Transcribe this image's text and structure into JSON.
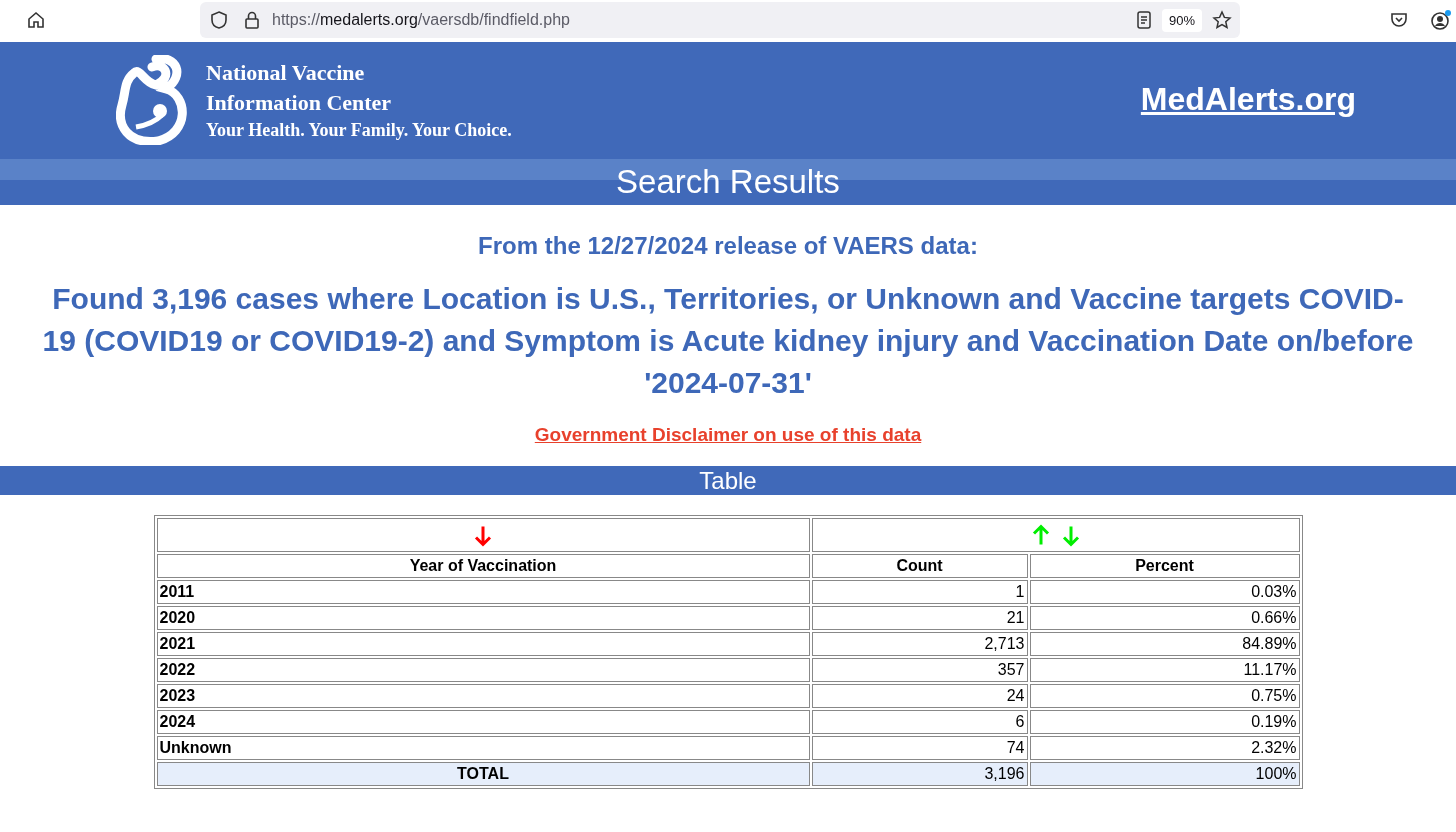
{
  "browser": {
    "url_host": "medalerts.org",
    "url_prefix": "https://",
    "url_path": "/vaersdb/findfield.php",
    "zoom": "90%"
  },
  "header": {
    "org_line_1": "National Vaccine",
    "org_line_2": "Information Center",
    "tagline": "Your Health. Your Family. Your Choice.",
    "site_link": "MedAlerts.org"
  },
  "page_title": "Search Results",
  "release": "From the 12/27/2024 release of VAERS data:",
  "summary": "Found 3,196 cases where Location is U.S., Territories, or Unknown and Vaccine targets COVID-19 (COVID19 or COVID19-2) and Symptom is Acute kidney injury and Vaccination Date on/before '2024-07-31'",
  "disclaimer_link": "Government Disclaimer on use of this data",
  "section_title": "Table",
  "table": {
    "sort_controls": [
      [
        {
          "kind": "down",
          "selected": true
        }
      ],
      [
        {
          "kind": "up",
          "selected": false
        },
        {
          "kind": "down",
          "selected": false
        }
      ]
    ],
    "columns": [
      "Year of Vaccination",
      "Count",
      "Percent"
    ],
    "rows": [
      {
        "year": "2011",
        "count": "1",
        "percent": "0.03%"
      },
      {
        "year": "2020",
        "count": "21",
        "percent": "0.66%"
      },
      {
        "year": "2021",
        "count": "2,713",
        "percent": "84.89%"
      },
      {
        "year": "2022",
        "count": "357",
        "percent": "11.17%"
      },
      {
        "year": "2023",
        "count": "24",
        "percent": "0.75%"
      },
      {
        "year": "2024",
        "count": "6",
        "percent": "0.19%"
      },
      {
        "year": "Unknown",
        "count": "74",
        "percent": "2.32%"
      }
    ],
    "total": {
      "label": "TOTAL",
      "count": "3,196",
      "percent": "100%"
    }
  }
}
